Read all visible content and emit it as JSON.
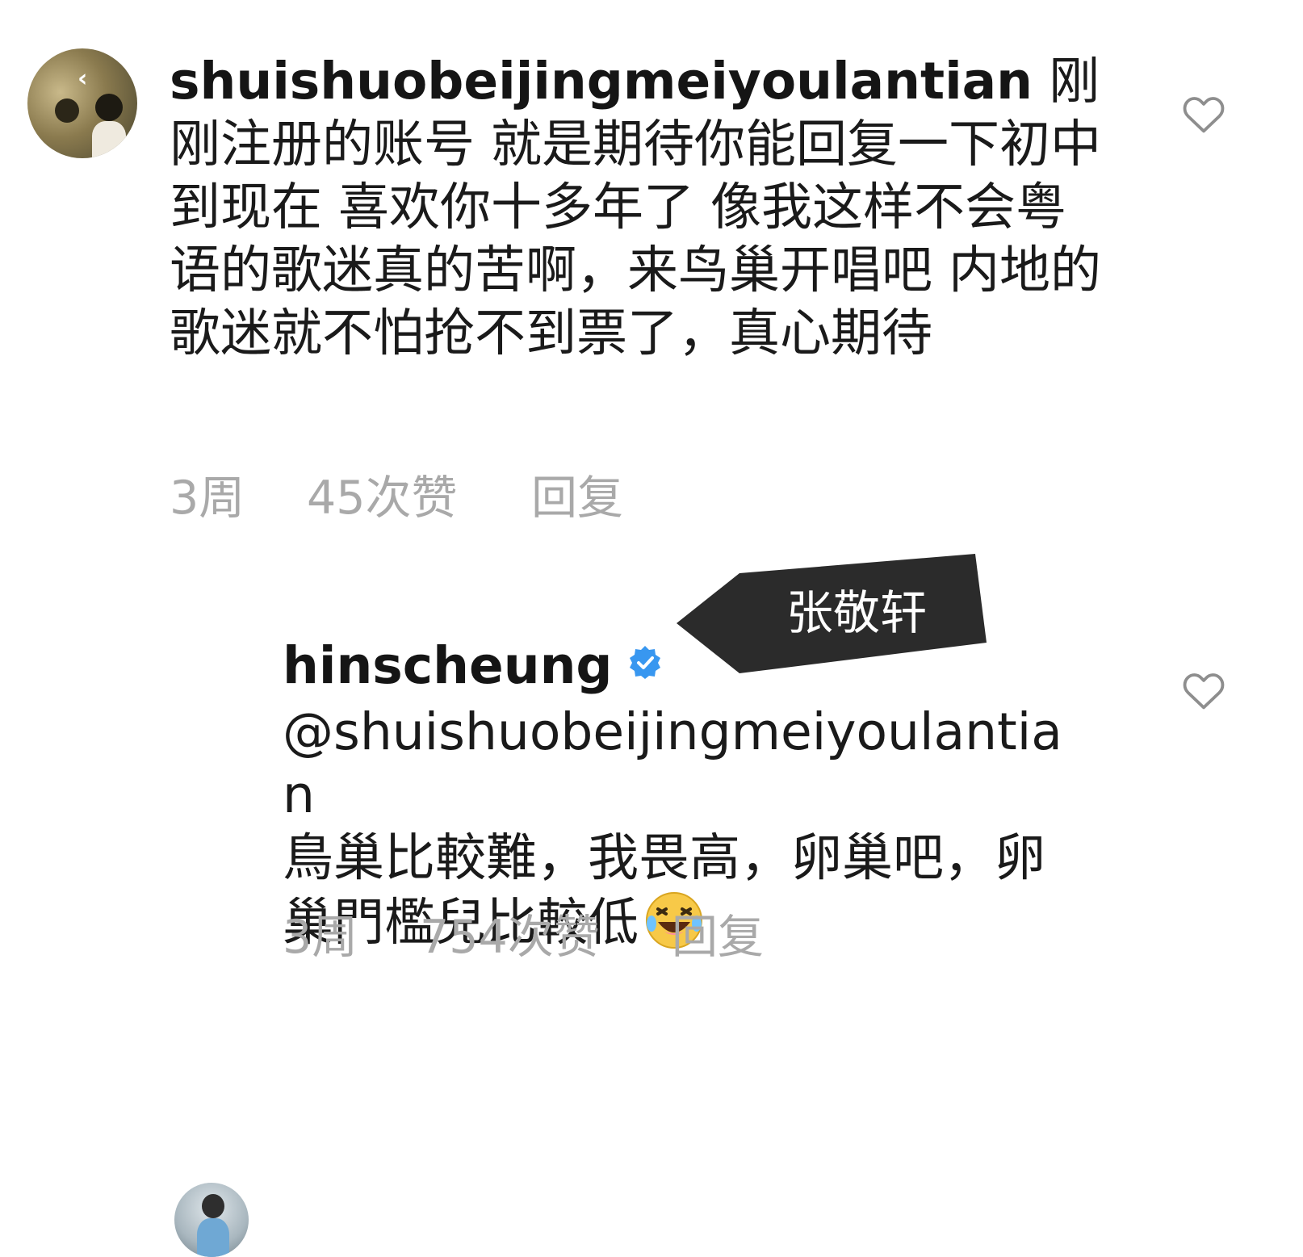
{
  "comments": [
    {
      "username": "shuishuobeijingmeiyoulantian",
      "text": "刚刚注册的账号 就是期待你能回复一下初中到现在 喜欢你十多年了 像我这样不会粤语的歌迷真的苦啊，来鸟巢开唱吧 内地的歌迷就不怕抢不到票了，真心期待",
      "time": "3周",
      "likes": "45次赞",
      "reply_label": "回复",
      "avatar_icon": "user-avatar",
      "like_icon": "heart-outline"
    },
    {
      "username": "hinscheung",
      "verified_icon": "verified-badge",
      "mention": "@shuishuobeijingmeiyoulantian",
      "text": "鳥巢比較難，我畏高，卵巢吧，卵巢門檻兒比較低",
      "emoji": "face-with-tears-of-joy",
      "time": "3周",
      "likes": "754次赞",
      "reply_label": "回复",
      "avatar_icon": "user-avatar",
      "like_icon": "heart-outline"
    }
  ],
  "annotation": {
    "label": "张敬轩",
    "background": "#2b2b2b"
  },
  "colors": {
    "meta_text": "#a9a9a9",
    "body_text": "#1a1a1a",
    "verified_blue": "#3897f0"
  }
}
